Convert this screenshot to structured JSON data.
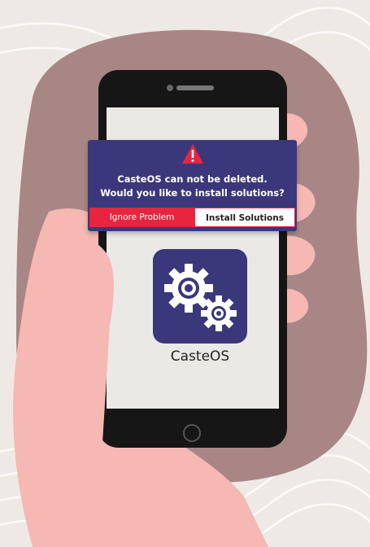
{
  "dialog": {
    "message_line1": "CasteOS can not be deleted.",
    "message_line2": "Would you like to install solutions?",
    "ignore_label": "Ignore Problem",
    "install_label": "Install Solutions",
    "accent_color": "#e8243f",
    "background_color": "#3a387a"
  },
  "app": {
    "name": "CasteOS",
    "icon": "gears-icon"
  },
  "colors": {
    "blob": "#a88686",
    "hand": "#f5b8b3",
    "phone": "#161616"
  }
}
